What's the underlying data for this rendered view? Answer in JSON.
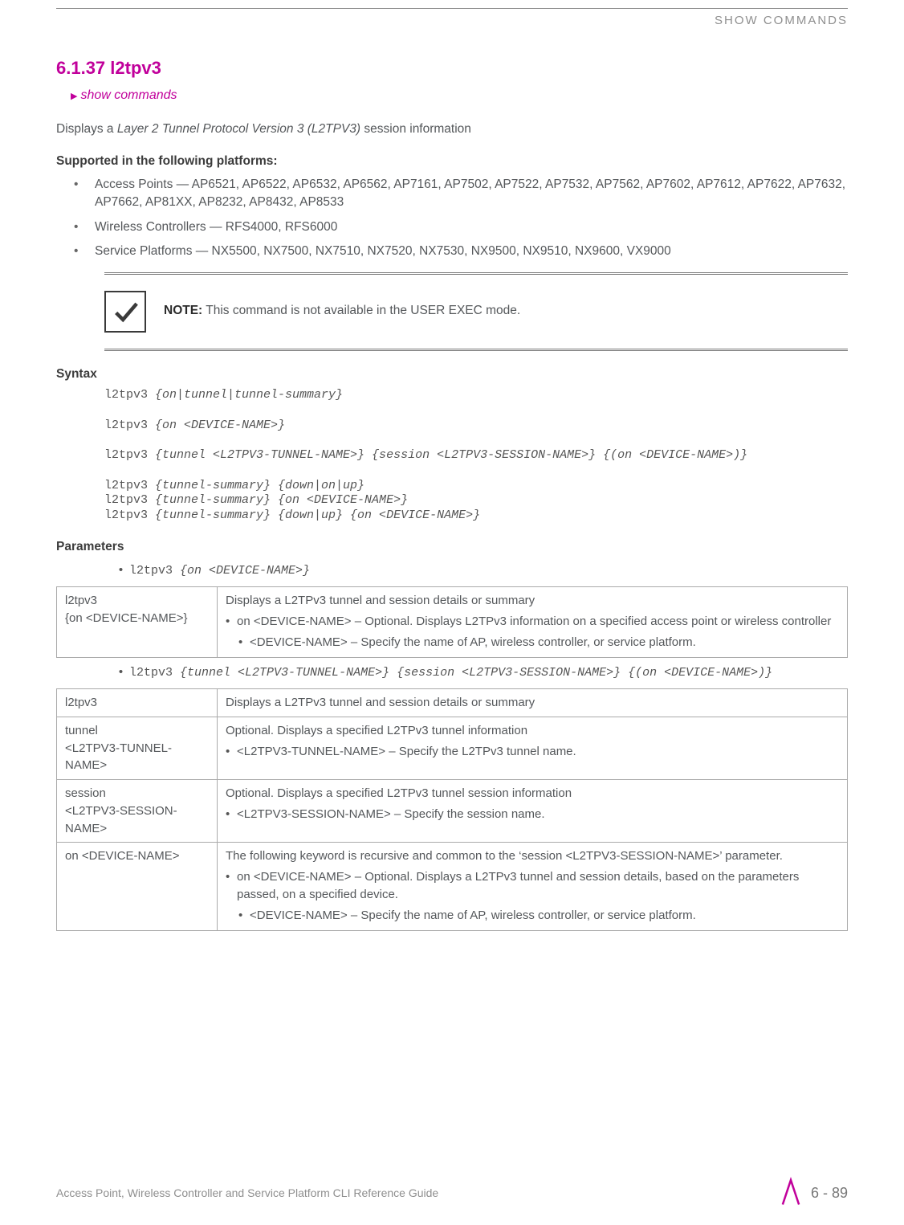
{
  "running_head": "SHOW COMMANDS",
  "section": {
    "number": "6.1.37",
    "title": "l2tpv3"
  },
  "breadcrumb": "show commands",
  "intro": {
    "prefix": "Displays a ",
    "ital": "Layer 2 Tunnel Protocol Version 3 (L2TPV3)",
    "suffix": " session information"
  },
  "supported_heading": "Supported in the following platforms:",
  "platforms": [
    "Access Points — AP6521, AP6522, AP6532, AP6562, AP7161, AP7502, AP7522, AP7532, AP7562, AP7602, AP7612, AP7622, AP7632, AP7662, AP81XX, AP8232, AP8432, AP8533",
    "Wireless Controllers — RFS4000, RFS6000",
    "Service Platforms — NX5500, NX7500, NX7510, NX7520, NX7530, NX9500, NX9510, NX9600, VX9000"
  ],
  "note": {
    "label": "NOTE:",
    "text": " This command is not available in the USER EXEC mode."
  },
  "syntax_heading": "Syntax",
  "syntax_lines": [
    {
      "cmd": "l2tpv3 ",
      "arg": "{on|tunnel|tunnel-summary}"
    },
    {
      "cmd": "",
      "arg": ""
    },
    {
      "cmd": "l2tpv3 ",
      "arg": "{on <DEVICE-NAME>}"
    },
    {
      "cmd": "",
      "arg": ""
    },
    {
      "cmd": "l2tpv3 ",
      "arg": "{tunnel <L2TPV3-TUNNEL-NAME>} {session <L2TPV3-SESSION-NAME>} {(on <DEVICE-NAME>)}"
    },
    {
      "cmd": "",
      "arg": ""
    },
    {
      "cmd": "l2tpv3 ",
      "arg": "{tunnel-summary} {down|on|up}"
    },
    {
      "cmd": "l2tpv3 ",
      "arg": "{tunnel-summary} {on <DEVICE-NAME>}"
    },
    {
      "cmd": "l2tpv3 ",
      "arg": "{tunnel-summary} {down|up} {on <DEVICE-NAME>}"
    }
  ],
  "parameters_heading": "Parameters",
  "param_intro_1": {
    "cmd": "l2tpv3 ",
    "arg": "{on <DEVICE-NAME>}"
  },
  "table1": {
    "r1c1a": "l2tpv3",
    "r1c1b": "{on <DEVICE-NAME>}",
    "r1c2_head": "Displays a L2TPv3 tunnel and session details or summary",
    "r1c2_b1": "on <DEVICE-NAME> – Optional. Displays L2TPv3 information on a specified access point or wireless controller",
    "r1c2_b1a": "<DEVICE-NAME> – Specify the name of AP, wireless controller, or service platform."
  },
  "param_intro_2": {
    "cmd": "l2tpv3 ",
    "arg": "{tunnel <L2TPV3-TUNNEL-NAME>} {session <L2TPV3-SESSION-NAME>} {(on <DEVICE-NAME>)}"
  },
  "table2": {
    "r1c1": "l2tpv3",
    "r1c2": "Displays a L2TPv3 tunnel and session details or summary",
    "r2c1a": "tunnel",
    "r2c1b": "<L2TPV3-TUNNEL-NAME>",
    "r2c2_head": "Optional. Displays a specified L2TPv3 tunnel information",
    "r2c2_b1": "<L2TPV3-TUNNEL-NAME> – Specify the L2TPv3 tunnel name.",
    "r3c1a": "session",
    "r3c1b": "<L2TPV3-SESSION-NAME>",
    "r3c2_head": "Optional. Displays a specified L2TPv3 tunnel session information",
    "r3c2_b1": "<L2TPV3-SESSION-NAME> – Specify the session name.",
    "r4c1": "on <DEVICE-NAME>",
    "r4c2_head": "The following keyword is recursive and common to the ‘session <L2TPV3-SESSION-NAME>’ parameter.",
    "r4c2_b1": "on <DEVICE-NAME> – Optional. Displays a L2TPv3 tunnel and session details, based on the parameters passed, on a specified device.",
    "r4c2_b1a": "<DEVICE-NAME> – Specify the name of AP, wireless controller, or service platform."
  },
  "footer": {
    "title": "Access Point, Wireless Controller and Service Platform CLI Reference Guide",
    "page": "6 - 89"
  }
}
